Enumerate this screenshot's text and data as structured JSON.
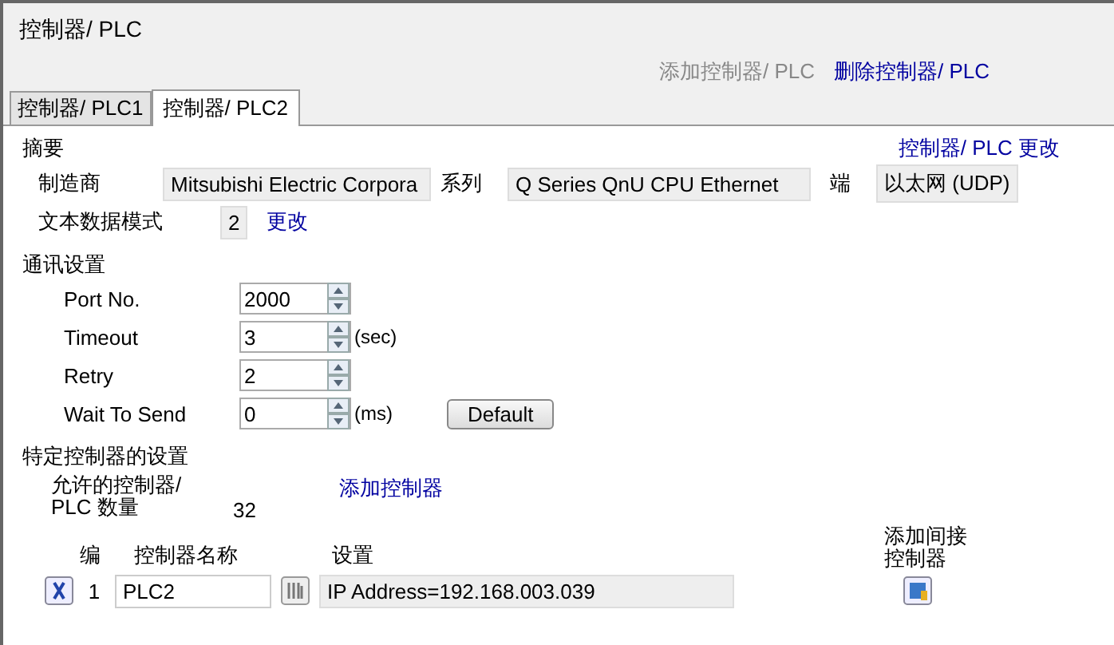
{
  "window": {
    "title": "控制器/ PLC"
  },
  "actions": [
    {
      "label": "添加控制器/ PLC",
      "disabled": true
    },
    {
      "label": "删除控制器/ PLC",
      "disabled": false
    }
  ],
  "tabs": [
    {
      "label": "控制器/ PLC1",
      "selected": false
    },
    {
      "label": "控制器/ PLC2",
      "selected": true
    }
  ],
  "summary": {
    "title": "摘要",
    "change_link": "控制器/ PLC 更改",
    "manufacturer_label": "制造商",
    "manufacturer": "Mitsubishi Electric Corpora",
    "series_label": "系列",
    "series": "Q Series QnU CPU Ethernet",
    "port_label": "端",
    "port": "以太网 (UDP)",
    "text_mode_label": "文本数据模式",
    "text_mode": "2",
    "text_mode_link": "更改"
  },
  "comm": {
    "title": "通讯设置",
    "fields": [
      {
        "label": "Port No.",
        "value": "2000"
      },
      {
        "label": "Timeout",
        "value": "3",
        "unit": "(sec)"
      },
      {
        "label": "Retry",
        "value": "2"
      },
      {
        "label": "Wait To Send",
        "value": "0",
        "unit": "(ms)"
      }
    ],
    "default_button": "Default"
  },
  "specific": {
    "title": "特定控制器的设置",
    "allowed_label": "允许的控制器/ PLC 数量",
    "allowed_value": "32",
    "add_link": "添加控制器",
    "columns": [
      "编",
      "控制器名称",
      "设置",
      "添加间接控制器"
    ],
    "rows": [
      {
        "number": "1",
        "name": "PLC2",
        "settings": "IP Address=192.168.003.039"
      }
    ]
  }
}
